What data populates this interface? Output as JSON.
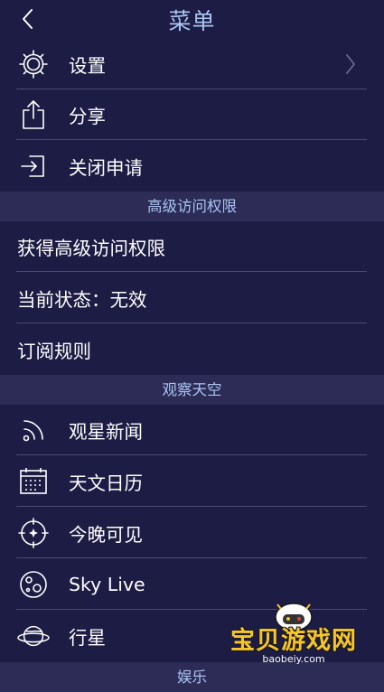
{
  "header": {
    "title": "菜单"
  },
  "menu_items": [
    {
      "label": "设置",
      "icon": "gear-icon"
    },
    {
      "label": "分享",
      "icon": "share-icon"
    },
    {
      "label": "关闭申请",
      "icon": "exit-icon"
    }
  ],
  "sections": [
    {
      "title": "高级访问权限"
    },
    {
      "title": "观察天空"
    },
    {
      "title": "娱乐"
    }
  ],
  "premium_items": [
    {
      "label": "获得高级访问权限"
    },
    {
      "label": "当前状态：无效"
    },
    {
      "label": "订阅规则"
    }
  ],
  "sky_items": [
    {
      "label": "观星新闻",
      "icon": "rss-icon"
    },
    {
      "label": "天文日历",
      "icon": "calendar-icon"
    },
    {
      "label": "今晚可见",
      "icon": "compass-icon"
    },
    {
      "label": "Sky Live",
      "icon": "moon-icon"
    },
    {
      "label": "行星",
      "icon": "planet-icon"
    }
  ],
  "watermark": {
    "text": "宝贝游戏网",
    "url": "baobeiy.com"
  },
  "colors": {
    "background": "#1c1c44",
    "section": "#2c2c56",
    "accent": "#a9c4f2",
    "divider": "#4a4a72"
  }
}
